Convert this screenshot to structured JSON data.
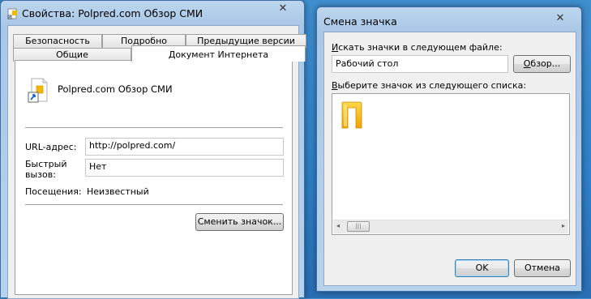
{
  "properties_window": {
    "title": "Свойства: Polpred.com Обзор СМИ",
    "close_glyph": "✕",
    "tabs_row1": [
      "Безопасность",
      "Подробно",
      "Предыдущие версии"
    ],
    "tabs_row2": [
      "Общие",
      "Документ Интернета"
    ],
    "active_tab": "Документ Интернета",
    "shortcut_name": "Polpred.com Обзор СМИ",
    "url_label": "URL-адрес:",
    "url_value": "http://polpred.com/",
    "hotkey_label_line1": "Быстрый",
    "hotkey_label_line2": "вызов:",
    "hotkey_value": "Нет",
    "visits_label": "Посещения:",
    "visits_value": "Неизвестный",
    "change_icon_button": "Сменить значок..."
  },
  "change_icon_dialog": {
    "title": "Смена значка",
    "close_glyph": "✕",
    "search_label_hotkey": "И",
    "search_label_rest": "скать значки в следующем файле:",
    "search_value": "Рабочий стол",
    "browse_button_hotkey": "О",
    "browse_button_rest": "бзор...",
    "select_label_hotkey": "В",
    "select_label_rest": "ыберите значок из следующего списка:",
    "ok_button": "OK",
    "cancel_button": "Отмена",
    "scroll_left": "◂",
    "scroll_right": "▸",
    "scroll_grip": "|||"
  },
  "colors": {
    "desktop": "#2f7fc8",
    "titlebar": "#bcd6ee",
    "dialog_bg": "#f0f0f0",
    "icon_accent": "#f5b800"
  }
}
